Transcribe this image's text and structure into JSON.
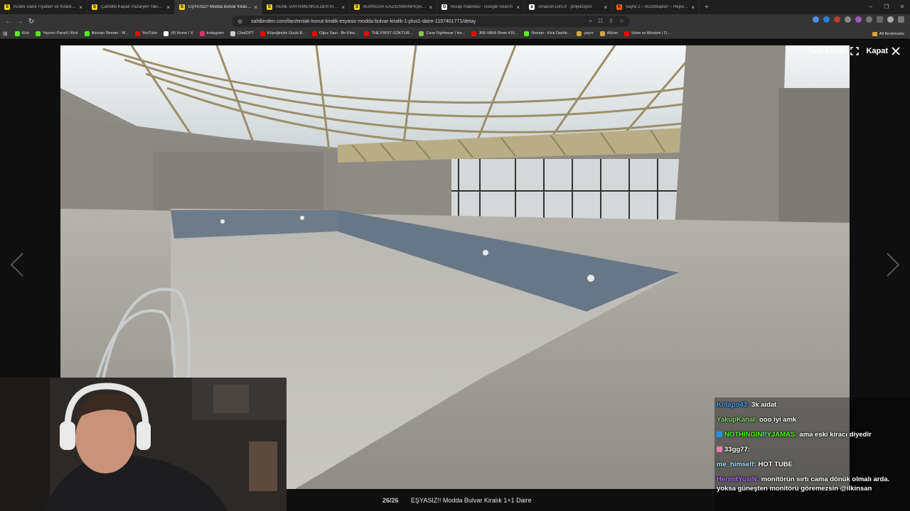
{
  "browser": {
    "tabs": [
      {
        "title": "Kiralık Daire Fiyatları ve Kiralık Ev İlanları",
        "favicon_color": "#f5d31f",
        "favicon_glyph": "S",
        "active": false
      },
      {
        "title": "Çamdibi Kapalı Pazaryeri Yakını Full Eşyalı",
        "favicon_color": "#f5d31f",
        "favicon_glyph": "S",
        "active": false
      },
      {
        "title": "EŞYASIZ!! Modda Bulvar Kiralık 1+1",
        "favicon_color": "#f5d31f",
        "favicon_glyph": "S",
        "active": true
      },
      {
        "title": "RENE GAYRİMENKULDEN KİRALIK 2+1",
        "favicon_color": "#f5d31f",
        "favicon_glyph": "S",
        "active": false
      },
      {
        "title": "BORNOVA GAZİOSMANPAŞA'DA KİRALIK",
        "favicon_color": "#f5d31f",
        "favicon_glyph": "S",
        "active": false
      },
      {
        "title": "hesap makinesi - Google Search",
        "favicon_color": "#ffffff",
        "favicon_glyph": "G",
        "active": false
      },
      {
        "title": "Amazon.com.tr : projeksiyon",
        "favicon_color": "#ffffff",
        "favicon_glyph": "a",
        "active": false
      },
      {
        "title": "Sayfa 2 – Buzdolapları – Hepsiburada",
        "favicon_color": "#ff6000",
        "favicon_glyph": "h",
        "active": false
      }
    ],
    "tab_close_glyph": "×",
    "new_tab_glyph": "+",
    "window_controls": [
      "–",
      "❐",
      "✕"
    ],
    "url": "sahibinden.com/ilan/emlak-konut-kiralik-esyasiz-modda-bulvar-kiralik-1-plus1-daire-1197401771/detay",
    "bookmarks": [
      {
        "label": "Kick",
        "color": "#53fc18"
      },
      {
        "label": "Yayıncı Paneli | Kick",
        "color": "#53fc18"
      },
      {
        "label": "ilkinsan Stream - W...",
        "color": "#53fc18"
      },
      {
        "label": "YouTube",
        "color": "#ff0000"
      },
      {
        "label": "(4) Home / X",
        "color": "#ffffff"
      },
      {
        "label": "Instagram",
        "color": "#e1306c"
      },
      {
        "label": "ChatGPT",
        "color": "#cccccc"
      },
      {
        "label": "Köpeğinizle Güçlü B...",
        "color": "#ff0000"
      },
      {
        "label": "Oğuz Sası - Bir Efsa...",
        "color": "#ff0000"
      },
      {
        "label": "THE FIRST GOKTUR...",
        "color": "#ff0000"
      },
      {
        "label": "Cave Fightwear | Ins...",
        "color": "#8bc34a"
      },
      {
        "label": "JRE MMA Show #16...",
        "color": "#ff0000"
      },
      {
        "label": "Stream - Kick Dashb...",
        "color": "#53fc18"
      },
      {
        "label": "yayın",
        "color": "#d8a23a"
      },
      {
        "label": "Albüm",
        "color": "#d8a23a"
      },
      {
        "label": "Islam vs Atheism | O...",
        "color": "#ff0000"
      }
    ],
    "all_bookmarks": "All Bookmarks"
  },
  "viewer": {
    "fullscreen_label": "Tam Ekran",
    "close_label": "Kapat",
    "counter": "26/26",
    "caption": "EŞYASIZ!! Modda Bulvar Kiralık 1+1 Daire"
  },
  "chat": {
    "messages": [
      {
        "user": "Kolapo43:",
        "text": "3k aidat",
        "color": "#3aa0ff",
        "badge": ""
      },
      {
        "user": "YakupKanal:",
        "text": "ooo iyi amk",
        "color": "#7ddf64",
        "badge": ""
      },
      {
        "user": "NOTHINGINPYJAMAS:",
        "text": "ama eski kiracı diyedir",
        "color": "#53fc18",
        "badge": "#1e90ff"
      },
      {
        "user": "33gg77:",
        "text": "",
        "color": "#ffffff",
        "badge": "#ff7ab0"
      },
      {
        "user": "me_himself:",
        "text": "HOT TUBE",
        "color": "#a4e7ff",
        "badge": ""
      },
      {
        "user": "HermitYusiN:",
        "text": "monitörün sırtı cama dönük olmalı arda. yoksa güneşten monitörü göremezsin @ilkinsan",
        "color": "#b26cff",
        "badge": ""
      }
    ]
  },
  "colors": {
    "chrome_dark": "#1f1f1f",
    "chrome_mid": "#353535",
    "viewer_bg": "#0f0f0f"
  }
}
